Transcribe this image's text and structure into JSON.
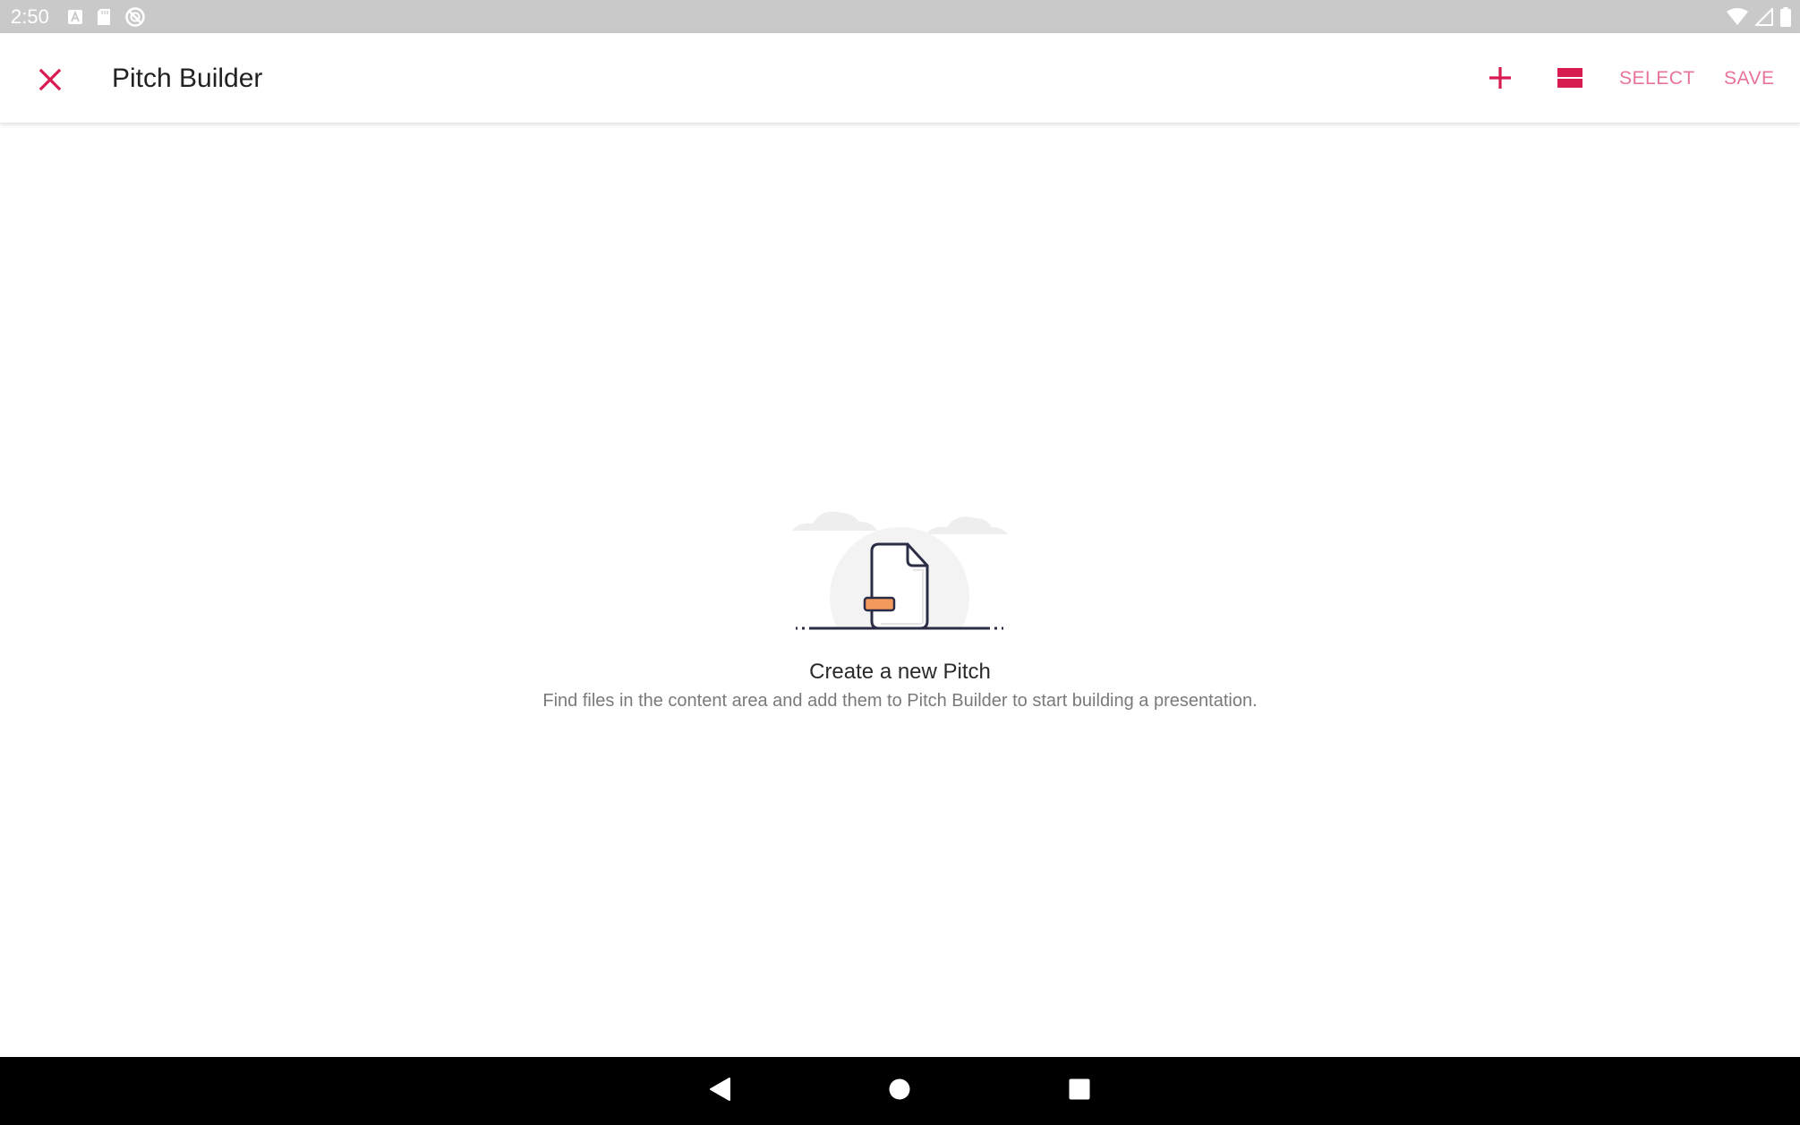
{
  "status_bar": {
    "time": "2:50",
    "left_icons": [
      "a-notification-icon",
      "sd-card-icon",
      "sync-icon"
    ],
    "right_icons": [
      "wifi-icon",
      "signal-icon",
      "battery-icon"
    ],
    "color": "#c9c9c9"
  },
  "app_bar": {
    "title": "Pitch Builder",
    "close_icon": "close-icon",
    "add_icon": "plus-icon",
    "layout_icon": "layout-icon",
    "select_label": "SELECT",
    "save_label": "SAVE",
    "accent_color": "#d81b50",
    "text_button_color": "#e8739a"
  },
  "empty_state": {
    "illustration": "document-illustration",
    "title": "Create a new Pitch",
    "description": "Find files in the content area and add them to Pitch Builder to start building a presentation."
  },
  "nav_bar": {
    "back_icon": "back-triangle-icon",
    "home_icon": "home-circle-icon",
    "recents_icon": "recents-square-icon"
  }
}
